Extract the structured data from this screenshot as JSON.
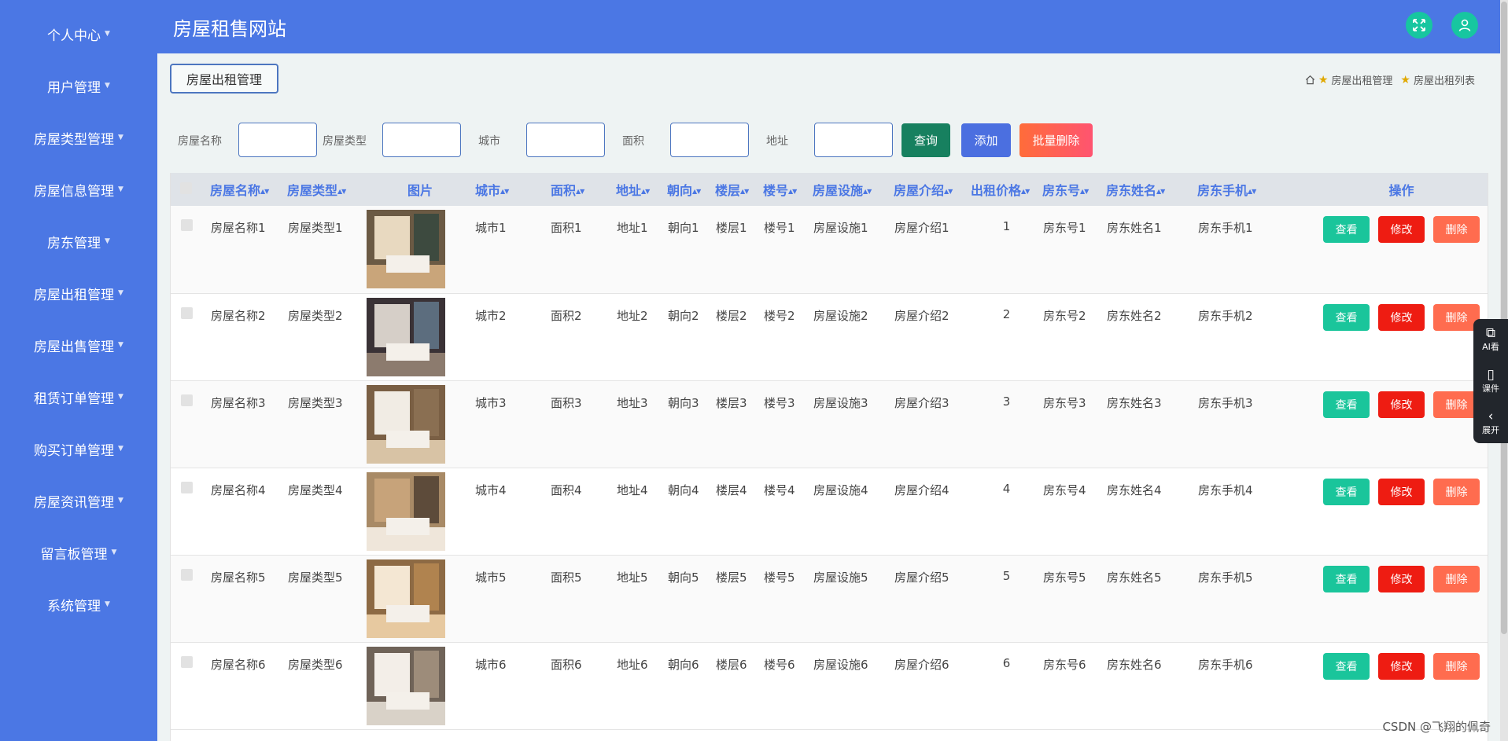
{
  "header": {
    "title": "房屋租售网站",
    "fullscreen_icon": "expand-arrows-icon",
    "user_icon": "user-icon"
  },
  "sidebar": {
    "items": [
      {
        "label": "个人中心"
      },
      {
        "label": "用户管理"
      },
      {
        "label": "房屋类型管理"
      },
      {
        "label": "房屋信息管理"
      },
      {
        "label": "房东管理"
      },
      {
        "label": "房屋出租管理"
      },
      {
        "label": "房屋出售管理"
      },
      {
        "label": "租赁订单管理"
      },
      {
        "label": "购买订单管理"
      },
      {
        "label": "房屋资讯管理"
      },
      {
        "label": "留言板管理"
      },
      {
        "label": "系统管理"
      }
    ]
  },
  "section_tab": "房屋出租管理",
  "breadcrumb": {
    "item1": "房屋出租管理",
    "item2": "房屋出租列表"
  },
  "search": {
    "name_label": "房屋名称",
    "type_label": "房屋类型",
    "city_label": "城市",
    "area_label": "面积",
    "address_label": "地址",
    "query_button": "查询",
    "add_button": "添加",
    "batch_delete_button": "批量删除"
  },
  "table": {
    "headers": {
      "name": "房屋名称",
      "type": "房屋类型",
      "image": "图片",
      "city": "城市",
      "area": "面积",
      "address": "地址",
      "orientation": "朝向",
      "floor": "楼层",
      "building": "楼号",
      "facilities": "房屋设施",
      "intro": "房屋介绍",
      "price": "出租价格",
      "landlord_no": "房东号",
      "landlord_name": "房东姓名",
      "landlord_phone": "房东手机",
      "actions": "操作"
    },
    "rows": [
      {
        "name": "房屋名称1",
        "type": "房屋类型1",
        "city": "城市1",
        "area": "面积1",
        "address": "地址1",
        "orientation": "朝向1",
        "floor": "楼层1",
        "building": "楼号1",
        "facilities": "房屋设施1",
        "intro": "房屋介绍1",
        "price": "1",
        "landlord_no": "房东号1",
        "landlord_name": "房东姓名1",
        "landlord_phone": "房东手机1",
        "view": "查看",
        "edit": "修改",
        "del": "删除"
      },
      {
        "name": "房屋名称2",
        "type": "房屋类型2",
        "city": "城市2",
        "area": "面积2",
        "address": "地址2",
        "orientation": "朝向2",
        "floor": "楼层2",
        "building": "楼号2",
        "facilities": "房屋设施2",
        "intro": "房屋介绍2",
        "price": "2",
        "landlord_no": "房东号2",
        "landlord_name": "房东姓名2",
        "landlord_phone": "房东手机2",
        "view": "查看",
        "edit": "修改",
        "del": "删除"
      },
      {
        "name": "房屋名称3",
        "type": "房屋类型3",
        "city": "城市3",
        "area": "面积3",
        "address": "地址3",
        "orientation": "朝向3",
        "floor": "楼层3",
        "building": "楼号3",
        "facilities": "房屋设施3",
        "intro": "房屋介绍3",
        "price": "3",
        "landlord_no": "房东号3",
        "landlord_name": "房东姓名3",
        "landlord_phone": "房东手机3",
        "view": "查看",
        "edit": "修改",
        "del": "删除"
      },
      {
        "name": "房屋名称4",
        "type": "房屋类型4",
        "city": "城市4",
        "area": "面积4",
        "address": "地址4",
        "orientation": "朝向4",
        "floor": "楼层4",
        "building": "楼号4",
        "facilities": "房屋设施4",
        "intro": "房屋介绍4",
        "price": "4",
        "landlord_no": "房东号4",
        "landlord_name": "房东姓名4",
        "landlord_phone": "房东手机4",
        "view": "查看",
        "edit": "修改",
        "del": "删除"
      },
      {
        "name": "房屋名称5",
        "type": "房屋类型5",
        "city": "城市5",
        "area": "面积5",
        "address": "地址5",
        "orientation": "朝向5",
        "floor": "楼层5",
        "building": "楼号5",
        "facilities": "房屋设施5",
        "intro": "房屋介绍5",
        "price": "5",
        "landlord_no": "房东号5",
        "landlord_name": "房东姓名5",
        "landlord_phone": "房东手机5",
        "view": "查看",
        "edit": "修改",
        "del": "删除"
      },
      {
        "name": "房屋名称6",
        "type": "房屋类型6",
        "city": "城市6",
        "area": "面积6",
        "address": "地址6",
        "orientation": "朝向6",
        "floor": "楼层6",
        "building": "楼号6",
        "facilities": "房屋设施6",
        "intro": "房屋介绍6",
        "price": "6",
        "landlord_no": "房东号6",
        "landlord_name": "房东姓名6",
        "landlord_phone": "房东手机6",
        "view": "查看",
        "edit": "修改",
        "del": "删除"
      }
    ]
  },
  "side_tools": {
    "ai_label": "AI看",
    "courseware_label": "课件",
    "expand_label": "展开"
  },
  "watermark": "CSDN @飞翔的佩奇",
  "colors": {
    "primary": "#4b77e4",
    "view": "#1ac59b",
    "edit": "#ee1c12",
    "delete": "#ff6c4f",
    "query": "#17805f"
  }
}
